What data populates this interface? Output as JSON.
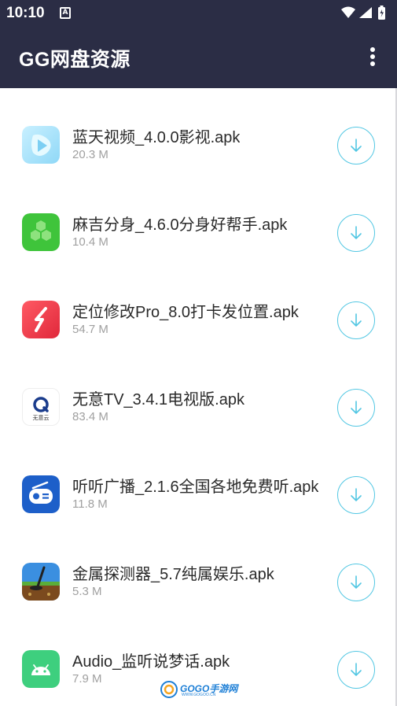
{
  "status_bar": {
    "time": "10:10",
    "notification_icon": "A",
    "icons": [
      "wifi-icon",
      "signal-icon",
      "battery-icon"
    ]
  },
  "app_bar": {
    "title": "GG网盘资源",
    "menu_icon": "more-vert-icon"
  },
  "files": [
    {
      "name": "蓝天视频_4.0.0影视.apk",
      "size": "20.3 M",
      "icon": "blue-sky-video-icon"
    },
    {
      "name": "麻吉分身_4.6.0分身好帮手.apk",
      "size": "10.4 M",
      "icon": "maji-clone-icon"
    },
    {
      "name": "定位修改Pro_8.0打卡发位置.apk",
      "size": "54.7 M",
      "icon": "location-modify-icon"
    },
    {
      "name": "无意TV_3.4.1电视版.apk",
      "size": "83.4 M",
      "icon": "wuyi-tv-icon"
    },
    {
      "name": "听听广播_2.1.6全国各地免费听.apk",
      "size": "11.8 M",
      "icon": "radio-icon"
    },
    {
      "name": "金属探测器_5.7纯属娱乐.apk",
      "size": "5.3 M",
      "icon": "metal-detector-icon"
    },
    {
      "name": "Audio_监听说梦话.apk",
      "size": "7.9 M",
      "icon": "android-icon"
    }
  ],
  "icon_labels": {
    "wuyi": "无意云"
  },
  "watermark": {
    "text": "GOGO手游网",
    "sub": "WWW.GOGOO.CN"
  },
  "colors": {
    "app_bar": "#2b2d45",
    "download_ring": "#52c7e3",
    "file_name": "#2a2a2a",
    "file_size": "#a0a0a0"
  }
}
